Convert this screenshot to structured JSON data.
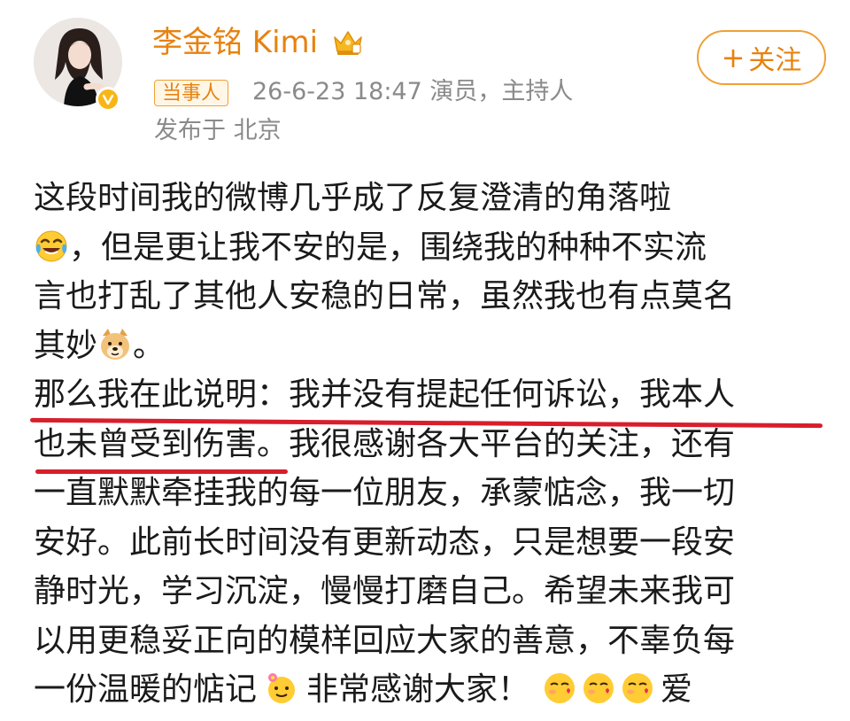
{
  "post": {
    "user": {
      "name": "李金铭 Kimi",
      "badge": "当事人",
      "follow_label": "关注"
    },
    "meta": {
      "time_and_role": "26-6-23 18:47  演员，主持人",
      "location": "发布于 北京"
    },
    "lines": [
      "这段时间我的微博几乎成了反复澄清的角落啦",
      "，但是更让我不安的是，围绕我的种种不实流",
      "言也打乱了其他人安稳的日常，虽然我也有点莫名",
      "其妙",
      "。",
      "那么我在此说明：我并没有提起任何诉讼，我本人",
      "也未曾受到伤害",
      "。我很感谢各大平台的关注，还有",
      "一直默默牵挂我的每一位朋友，承蒙惦念，我一切",
      "安好。此前长时间没有更新动态，只是想要一段安",
      "静时光，学习沉淀，慢慢打磨自己。希望未来我可",
      "以用更稳妥正向的模样回应大家的善意，不辜负每",
      "一份温暖的惦记",
      "非常感谢大家！",
      "爱"
    ]
  },
  "icons": {
    "avatar": "avatar-photo",
    "verified": "verified-v-icon",
    "crown": "crown-icon",
    "emoji_laugh": "tears-of-joy-emoji",
    "emoji_doge": "doge-emoji",
    "emoji_flower": "flower-emoji",
    "emoji_kiss": "blowing-kiss-emoji"
  },
  "colors": {
    "username": "#e7820f",
    "follow_border": "#f0a035",
    "meta": "#8a8a8a",
    "underline": "#d81e2c",
    "verified": "#f8b616"
  }
}
